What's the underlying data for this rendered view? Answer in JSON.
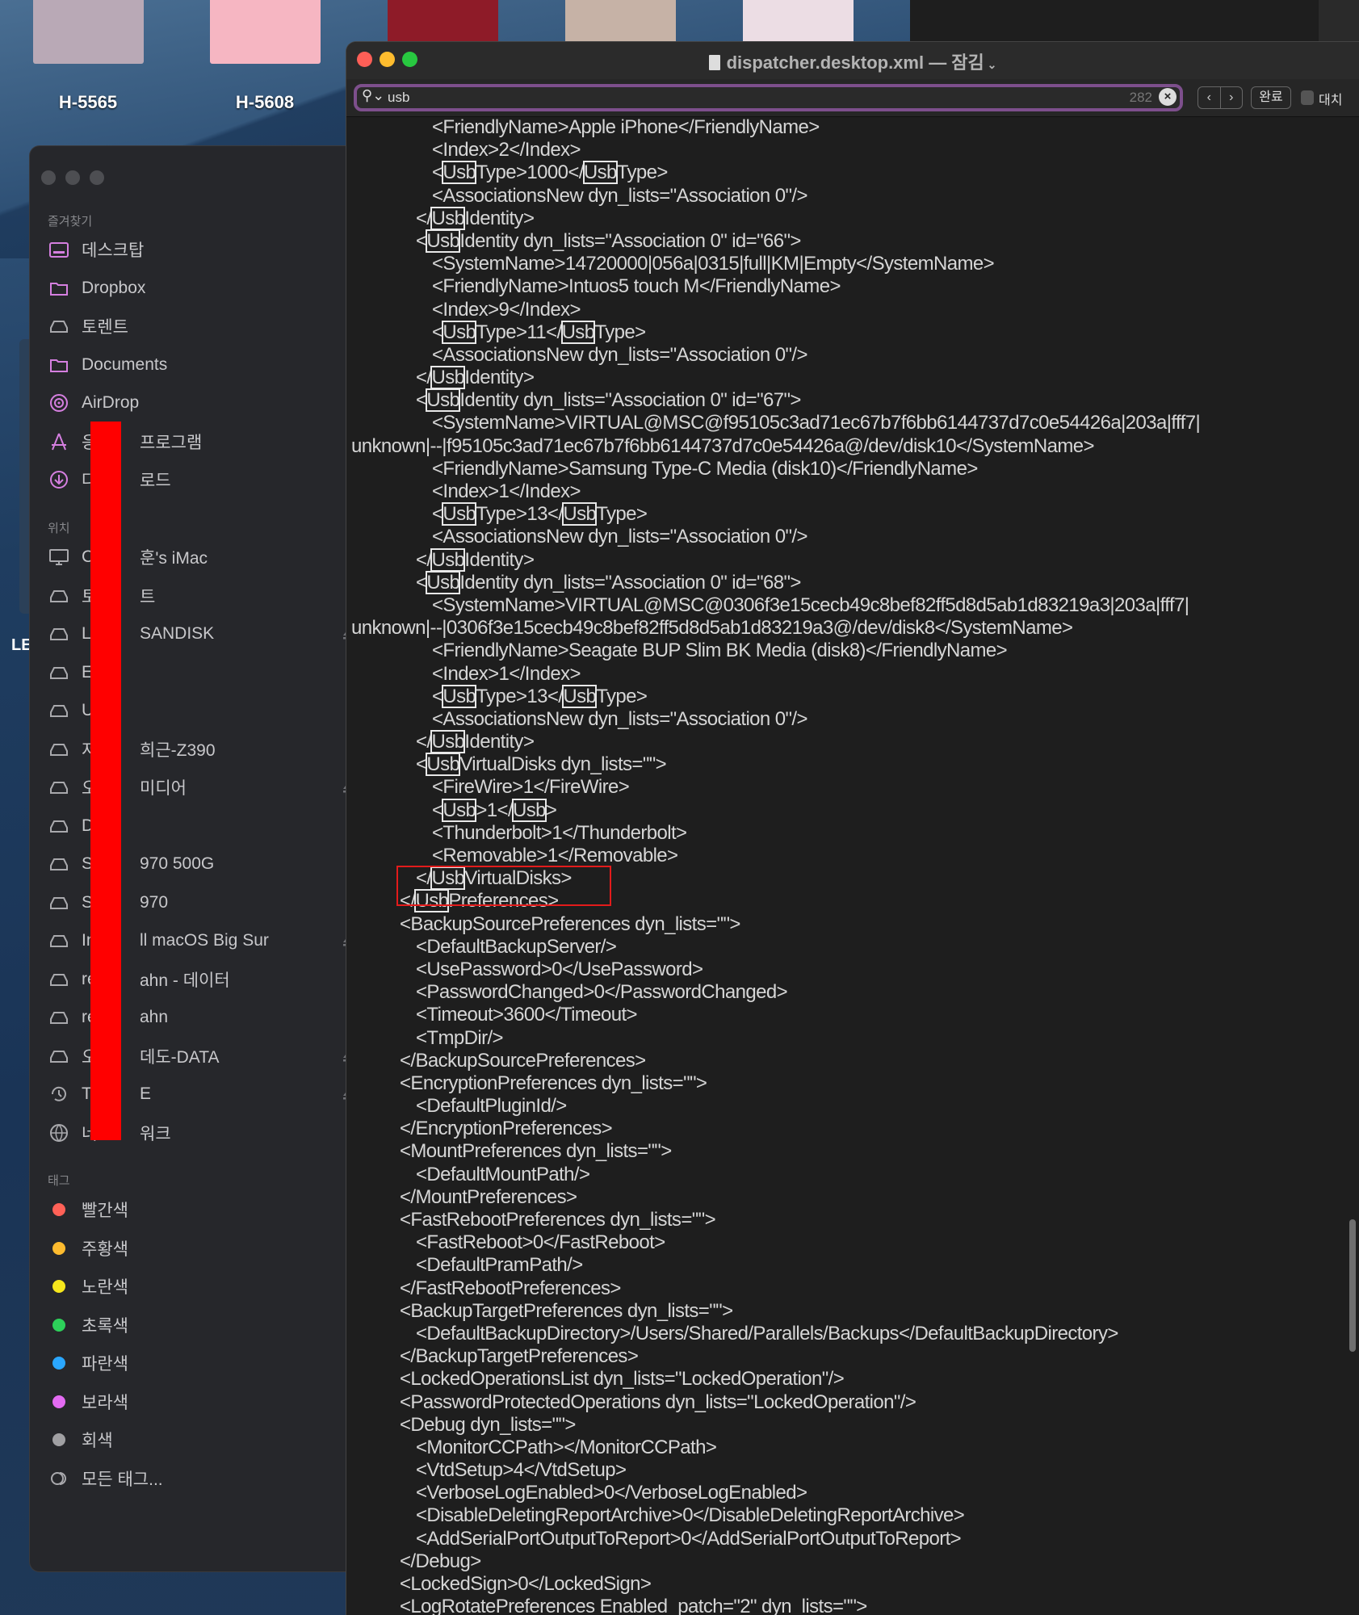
{
  "desktop": {
    "icons": [
      {
        "label": "H-5565",
        "color": "#b9a9b6"
      },
      {
        "label": "H-5608",
        "color": "#f6b6c2"
      },
      {
        "label": "",
        "color": "#8e1b28"
      },
      {
        "label": "",
        "color": "#c6b2a6"
      },
      {
        "label": "",
        "color": "#ecdde4"
      }
    ],
    "edge_label": "LE"
  },
  "finder": {
    "favorites_header": "즐겨찾기",
    "favorites": [
      {
        "icon": "desktop-icon",
        "pre": "데스크탑",
        "post": ""
      },
      {
        "icon": "folder-icon",
        "pre": "Dropbox",
        "post": ""
      },
      {
        "icon": "drive-icon",
        "pre": "토렌트",
        "post": ""
      },
      {
        "icon": "folder-icon",
        "pre": "Documents",
        "post": ""
      },
      {
        "icon": "airdrop-icon",
        "pre": "AirDrop",
        "post": ""
      },
      {
        "icon": "applications-icon",
        "pre": "응",
        "post": "프로그램"
      },
      {
        "icon": "download-icon",
        "pre": "다",
        "post": "로드"
      }
    ],
    "locations_header": "위치",
    "locations": [
      {
        "icon": "imac-icon",
        "pre": "C",
        "post": "훈's iMac",
        "eject": false
      },
      {
        "icon": "drive-icon",
        "pre": "토",
        "post": "트",
        "eject": false
      },
      {
        "icon": "drive-icon",
        "pre": "L",
        "post": "SANDISK",
        "eject": true
      },
      {
        "icon": "drive-icon",
        "pre": "E",
        "post": "",
        "eject": false
      },
      {
        "icon": "drive-icon",
        "pre": "U",
        "post": "",
        "eject": false
      },
      {
        "icon": "drive-icon",
        "pre": "저",
        "post": "희근-Z390",
        "eject": false
      },
      {
        "icon": "drive-icon",
        "pre": "오",
        "post": "미디어",
        "eject": true
      },
      {
        "icon": "drive-icon",
        "pre": "D",
        "post": "",
        "eject": false
      },
      {
        "icon": "drive-icon",
        "pre": "S",
        "post": "970 500G",
        "eject": false
      },
      {
        "icon": "drive-icon",
        "pre": "S",
        "post": "970",
        "eject": false
      },
      {
        "icon": "drive-icon",
        "pre": "In",
        "post": "ll macOS Big Sur",
        "eject": true
      },
      {
        "icon": "drive-icon",
        "pre": "re",
        "post": "ahn - 데이터",
        "eject": false
      },
      {
        "icon": "drive-icon",
        "pre": "re",
        "post": "ahn",
        "eject": false
      },
      {
        "icon": "drive-icon",
        "pre": "오",
        "post": "데도-DATA",
        "eject": true
      },
      {
        "icon": "time-machine-icon",
        "pre": "T",
        "post": "E",
        "eject": true
      },
      {
        "icon": "network-icon",
        "pre": "네",
        "post": "워크",
        "eject": false
      }
    ],
    "tags_header": "태그",
    "tags": [
      {
        "label": "빨간색",
        "color": "#ff6157"
      },
      {
        "label": "주황색",
        "color": "#fdbb2f"
      },
      {
        "label": "노란색",
        "color": "#f6e71c"
      },
      {
        "label": "초록색",
        "color": "#2dd15a"
      },
      {
        "label": "파란색",
        "color": "#2aa7ff"
      },
      {
        "label": "보라색",
        "color": "#e36bf2"
      },
      {
        "label": "회색",
        "color": "#a0a0a3"
      }
    ],
    "all_tags": "모든 태그...",
    "icon_color": "#d57fe0"
  },
  "editor": {
    "title": "dispatcher.desktop.xml — 잠김",
    "search": {
      "value": "usb",
      "count": "282"
    },
    "prev": "‹",
    "next": "›",
    "done": "완료",
    "replace_label": "대치",
    "highlight_term": "Usb",
    "lines": [
      "\t\t\t\t\t<FriendlyName>Apple iPhone</FriendlyName>",
      "\t\t\t\t\t<Index>2</Index>",
      "\t\t\t\t\t<UsbType>1000</UsbType>",
      "\t\t\t\t\t<AssociationsNew dyn_lists=\"Association 0\"/>",
      "\t\t\t\t</UsbIdentity>",
      "\t\t\t\t<UsbIdentity dyn_lists=\"Association 0\" id=\"66\">",
      "\t\t\t\t\t<SystemName>14720000|056a|0315|full|KM|Empty</SystemName>",
      "\t\t\t\t\t<FriendlyName>Intuos5 touch M</FriendlyName>",
      "\t\t\t\t\t<Index>9</Index>",
      "\t\t\t\t\t<UsbType>11</UsbType>",
      "\t\t\t\t\t<AssociationsNew dyn_lists=\"Association 0\"/>",
      "\t\t\t\t</UsbIdentity>",
      "\t\t\t\t<UsbIdentity dyn_lists=\"Association 0\" id=\"67\">",
      "\t\t\t\t\t<SystemName>VIRTUAL@MSC@f95105c3ad71ec67b7f6bb6144737d7c0e54426a|203a|fff7|",
      "unknown|--|f95105c3ad71ec67b7f6bb6144737d7c0e54426a@/dev/disk10</SystemName>",
      "\t\t\t\t\t<FriendlyName>Samsung Type-C Media (disk10)</FriendlyName>",
      "\t\t\t\t\t<Index>1</Index>",
      "\t\t\t\t\t<UsbType>13</UsbType>",
      "\t\t\t\t\t<AssociationsNew dyn_lists=\"Association 0\"/>",
      "\t\t\t\t</UsbIdentity>",
      "\t\t\t\t<UsbIdentity dyn_lists=\"Association 0\" id=\"68\">",
      "\t\t\t\t\t<SystemName>VIRTUAL@MSC@0306f3e15cecb49c8bef82ff5d8d5ab1d83219a3|203a|fff7|",
      "unknown|--|0306f3e15cecb49c8bef82ff5d8d5ab1d83219a3@/dev/disk8</SystemName>",
      "\t\t\t\t\t<FriendlyName>Seagate BUP Slim BK Media (disk8)</FriendlyName>",
      "\t\t\t\t\t<Index>1</Index>",
      "\t\t\t\t\t<UsbType>13</UsbType>",
      "\t\t\t\t\t<AssociationsNew dyn_lists=\"Association 0\"/>",
      "\t\t\t\t</UsbIdentity>",
      "\t\t\t\t<UsbVirtualDisks dyn_lists=\"\">",
      "\t\t\t\t\t<FireWire>1</FireWire>",
      "\t\t\t\t\t<Usb>1</Usb>",
      "\t\t\t\t\t<Thunderbolt>1</Thunderbolt>",
      "\t\t\t\t\t<Removable>1</Removable>",
      "\t\t\t\t</UsbVirtualDisks>",
      "\t\t\t</UsbPreferences>",
      "\t\t\t<BackupSourcePreferences dyn_lists=\"\">",
      "\t\t\t\t<DefaultBackupServer/>",
      "\t\t\t\t<UsePassword>0</UsePassword>",
      "\t\t\t\t<PasswordChanged>0</PasswordChanged>",
      "\t\t\t\t<Timeout>3600</Timeout>",
      "\t\t\t\t<TmpDir/>",
      "\t\t\t</BackupSourcePreferences>",
      "\t\t\t<EncryptionPreferences dyn_lists=\"\">",
      "\t\t\t\t<DefaultPluginId/>",
      "\t\t\t</EncryptionPreferences>",
      "\t\t\t<MountPreferences dyn_lists=\"\">",
      "\t\t\t\t<DefaultMountPath/>",
      "\t\t\t</MountPreferences>",
      "\t\t\t<FastRebootPreferences dyn_lists=\"\">",
      "\t\t\t\t<FastReboot>0</FastReboot>",
      "\t\t\t\t<DefaultPramPath/>",
      "\t\t\t</FastRebootPreferences>",
      "\t\t\t<BackupTargetPreferences dyn_lists=\"\">",
      "\t\t\t\t<DefaultBackupDirectory>/Users/Shared/Parallels/Backups</DefaultBackupDirectory>",
      "\t\t\t</BackupTargetPreferences>",
      "\t\t\t<LockedOperationsList dyn_lists=\"LockedOperation\"/>",
      "\t\t\t<PasswordProtectedOperations dyn_lists=\"LockedOperation\"/>",
      "\t\t\t<Debug dyn_lists=\"\">",
      "\t\t\t\t<MonitorCCPath></MonitorCCPath>",
      "\t\t\t\t<VtdSetup>4</VtdSetup>",
      "\t\t\t\t<VerboseLogEnabled>0</VerboseLogEnabled>",
      "\t\t\t\t<DisableDeletingReportArchive>0</DisableDeletingReportArchive>",
      "\t\t\t\t<AddSerialPortOutputToReport>0</AddSerialPortOutputToReport>",
      "\t\t\t</Debug>",
      "\t\t\t<LockedSign>0</LockedSign>",
      "\t\t\t<LogRotatePreferences Enabled_patch=\"2\" dyn_lists=\"\">"
    ]
  }
}
